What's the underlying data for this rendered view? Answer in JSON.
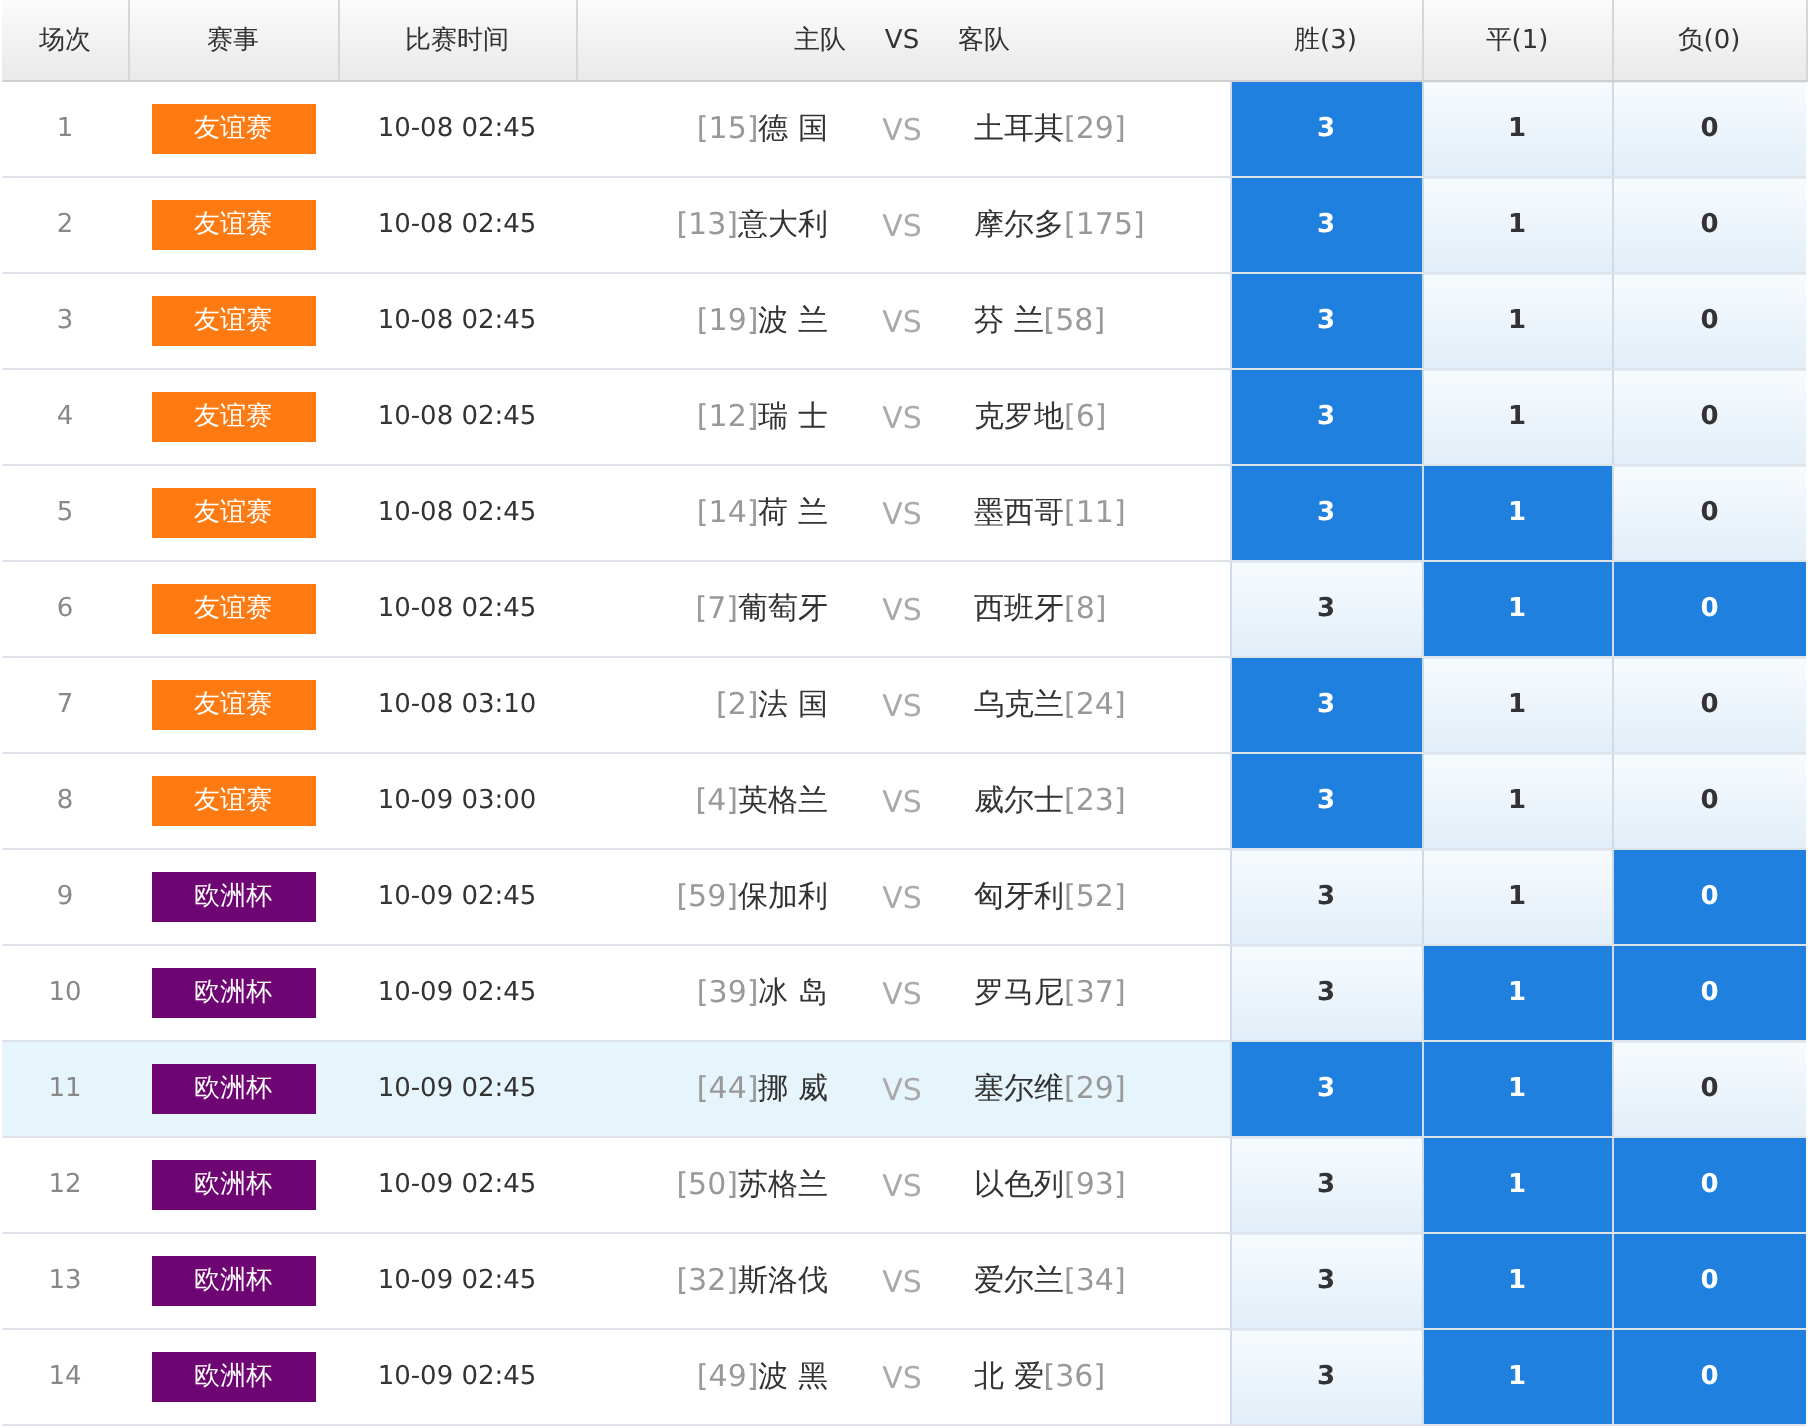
{
  "table": {
    "columns": [
      "场次",
      "赛事",
      "比赛时间",
      "主队",
      "VS",
      "客队",
      "胜(3)",
      "平(1)",
      "负(0)"
    ],
    "rows": [
      {
        "no": "1",
        "league": {
          "label": "友谊赛",
          "color": "#ff7a10"
        },
        "time": "10-08 02:45",
        "home_rank": "[15]",
        "home": "德 国",
        "vs": "VS",
        "away": "土耳其",
        "away_rank": "[29]",
        "selected": false,
        "picks": [
          {
            "label": "3",
            "selected": true
          },
          {
            "label": "1",
            "selected": false
          },
          {
            "label": "0",
            "selected": false
          }
        ]
      },
      {
        "no": "2",
        "league": {
          "label": "友谊赛",
          "color": "#ff7a10"
        },
        "time": "10-08 02:45",
        "home_rank": "[13]",
        "home": "意大利",
        "vs": "VS",
        "away": "摩尔多",
        "away_rank": "[175]",
        "selected": false,
        "picks": [
          {
            "label": "3",
            "selected": true
          },
          {
            "label": "1",
            "selected": false
          },
          {
            "label": "0",
            "selected": false
          }
        ]
      },
      {
        "no": "3",
        "league": {
          "label": "友谊赛",
          "color": "#ff7a10"
        },
        "time": "10-08 02:45",
        "home_rank": "[19]",
        "home": "波 兰",
        "vs": "VS",
        "away": "芬 兰",
        "away_rank": "[58]",
        "selected": false,
        "picks": [
          {
            "label": "3",
            "selected": true
          },
          {
            "label": "1",
            "selected": false
          },
          {
            "label": "0",
            "selected": false
          }
        ]
      },
      {
        "no": "4",
        "league": {
          "label": "友谊赛",
          "color": "#ff7a10"
        },
        "time": "10-08 02:45",
        "home_rank": "[12]",
        "home": "瑞 士",
        "vs": "VS",
        "away": "克罗地",
        "away_rank": "[6]",
        "selected": false,
        "picks": [
          {
            "label": "3",
            "selected": true
          },
          {
            "label": "1",
            "selected": false
          },
          {
            "label": "0",
            "selected": false
          }
        ]
      },
      {
        "no": "5",
        "league": {
          "label": "友谊赛",
          "color": "#ff7a10"
        },
        "time": "10-08 02:45",
        "home_rank": "[14]",
        "home": "荷 兰",
        "vs": "VS",
        "away": "墨西哥",
        "away_rank": "[11]",
        "selected": false,
        "picks": [
          {
            "label": "3",
            "selected": true
          },
          {
            "label": "1",
            "selected": true
          },
          {
            "label": "0",
            "selected": false
          }
        ]
      },
      {
        "no": "6",
        "league": {
          "label": "友谊赛",
          "color": "#ff7a10"
        },
        "time": "10-08 02:45",
        "home_rank": "[7]",
        "home": "葡萄牙",
        "vs": "VS",
        "away": "西班牙",
        "away_rank": "[8]",
        "selected": false,
        "picks": [
          {
            "label": "3",
            "selected": false
          },
          {
            "label": "1",
            "selected": true
          },
          {
            "label": "0",
            "selected": true
          }
        ]
      },
      {
        "no": "7",
        "league": {
          "label": "友谊赛",
          "color": "#ff7a10"
        },
        "time": "10-08 03:10",
        "home_rank": "[2]",
        "home": "法 国",
        "vs": "VS",
        "away": "乌克兰",
        "away_rank": "[24]",
        "selected": false,
        "picks": [
          {
            "label": "3",
            "selected": true
          },
          {
            "label": "1",
            "selected": false
          },
          {
            "label": "0",
            "selected": false
          }
        ]
      },
      {
        "no": "8",
        "league": {
          "label": "友谊赛",
          "color": "#ff7a10"
        },
        "time": "10-09 03:00",
        "home_rank": "[4]",
        "home": "英格兰",
        "vs": "VS",
        "away": "威尔士",
        "away_rank": "[23]",
        "selected": false,
        "picks": [
          {
            "label": "3",
            "selected": true
          },
          {
            "label": "1",
            "selected": false
          },
          {
            "label": "0",
            "selected": false
          }
        ]
      },
      {
        "no": "9",
        "league": {
          "label": "欧洲杯",
          "color": "#6e0573"
        },
        "time": "10-09 02:45",
        "home_rank": "[59]",
        "home": "保加利",
        "vs": "VS",
        "away": "匈牙利",
        "away_rank": "[52]",
        "selected": false,
        "picks": [
          {
            "label": "3",
            "selected": false
          },
          {
            "label": "1",
            "selected": false
          },
          {
            "label": "0",
            "selected": true
          }
        ]
      },
      {
        "no": "10",
        "league": {
          "label": "欧洲杯",
          "color": "#6e0573"
        },
        "time": "10-09 02:45",
        "home_rank": "[39]",
        "home": "冰 岛",
        "vs": "VS",
        "away": "罗马尼",
        "away_rank": "[37]",
        "selected": false,
        "picks": [
          {
            "label": "3",
            "selected": false
          },
          {
            "label": "1",
            "selected": true
          },
          {
            "label": "0",
            "selected": true
          }
        ]
      },
      {
        "no": "11",
        "league": {
          "label": "欧洲杯",
          "color": "#6e0573"
        },
        "time": "10-09 02:45",
        "home_rank": "[44]",
        "home": "挪 威",
        "vs": "VS",
        "away": "塞尔维",
        "away_rank": "[29]",
        "selected": true,
        "picks": [
          {
            "label": "3",
            "selected": true
          },
          {
            "label": "1",
            "selected": true
          },
          {
            "label": "0",
            "selected": false
          }
        ]
      },
      {
        "no": "12",
        "league": {
          "label": "欧洲杯",
          "color": "#6e0573"
        },
        "time": "10-09 02:45",
        "home_rank": "[50]",
        "home": "苏格兰",
        "vs": "VS",
        "away": "以色列",
        "away_rank": "[93]",
        "selected": false,
        "picks": [
          {
            "label": "3",
            "selected": false
          },
          {
            "label": "1",
            "selected": true
          },
          {
            "label": "0",
            "selected": true
          }
        ]
      },
      {
        "no": "13",
        "league": {
          "label": "欧洲杯",
          "color": "#6e0573"
        },
        "time": "10-09 02:45",
        "home_rank": "[32]",
        "home": "斯洛伐",
        "vs": "VS",
        "away": "爱尔兰",
        "away_rank": "[34]",
        "selected": false,
        "picks": [
          {
            "label": "3",
            "selected": false
          },
          {
            "label": "1",
            "selected": true
          },
          {
            "label": "0",
            "selected": true
          }
        ]
      },
      {
        "no": "14",
        "league": {
          "label": "欧洲杯",
          "color": "#6e0573"
        },
        "time": "10-09 02:45",
        "home_rank": "[49]",
        "home": "波 黑",
        "vs": "VS",
        "away": "北 爱",
        "away_rank": "[36]",
        "selected": false,
        "picks": [
          {
            "label": "3",
            "selected": false
          },
          {
            "label": "1",
            "selected": true
          },
          {
            "label": "0",
            "selected": true
          }
        ]
      }
    ]
  }
}
